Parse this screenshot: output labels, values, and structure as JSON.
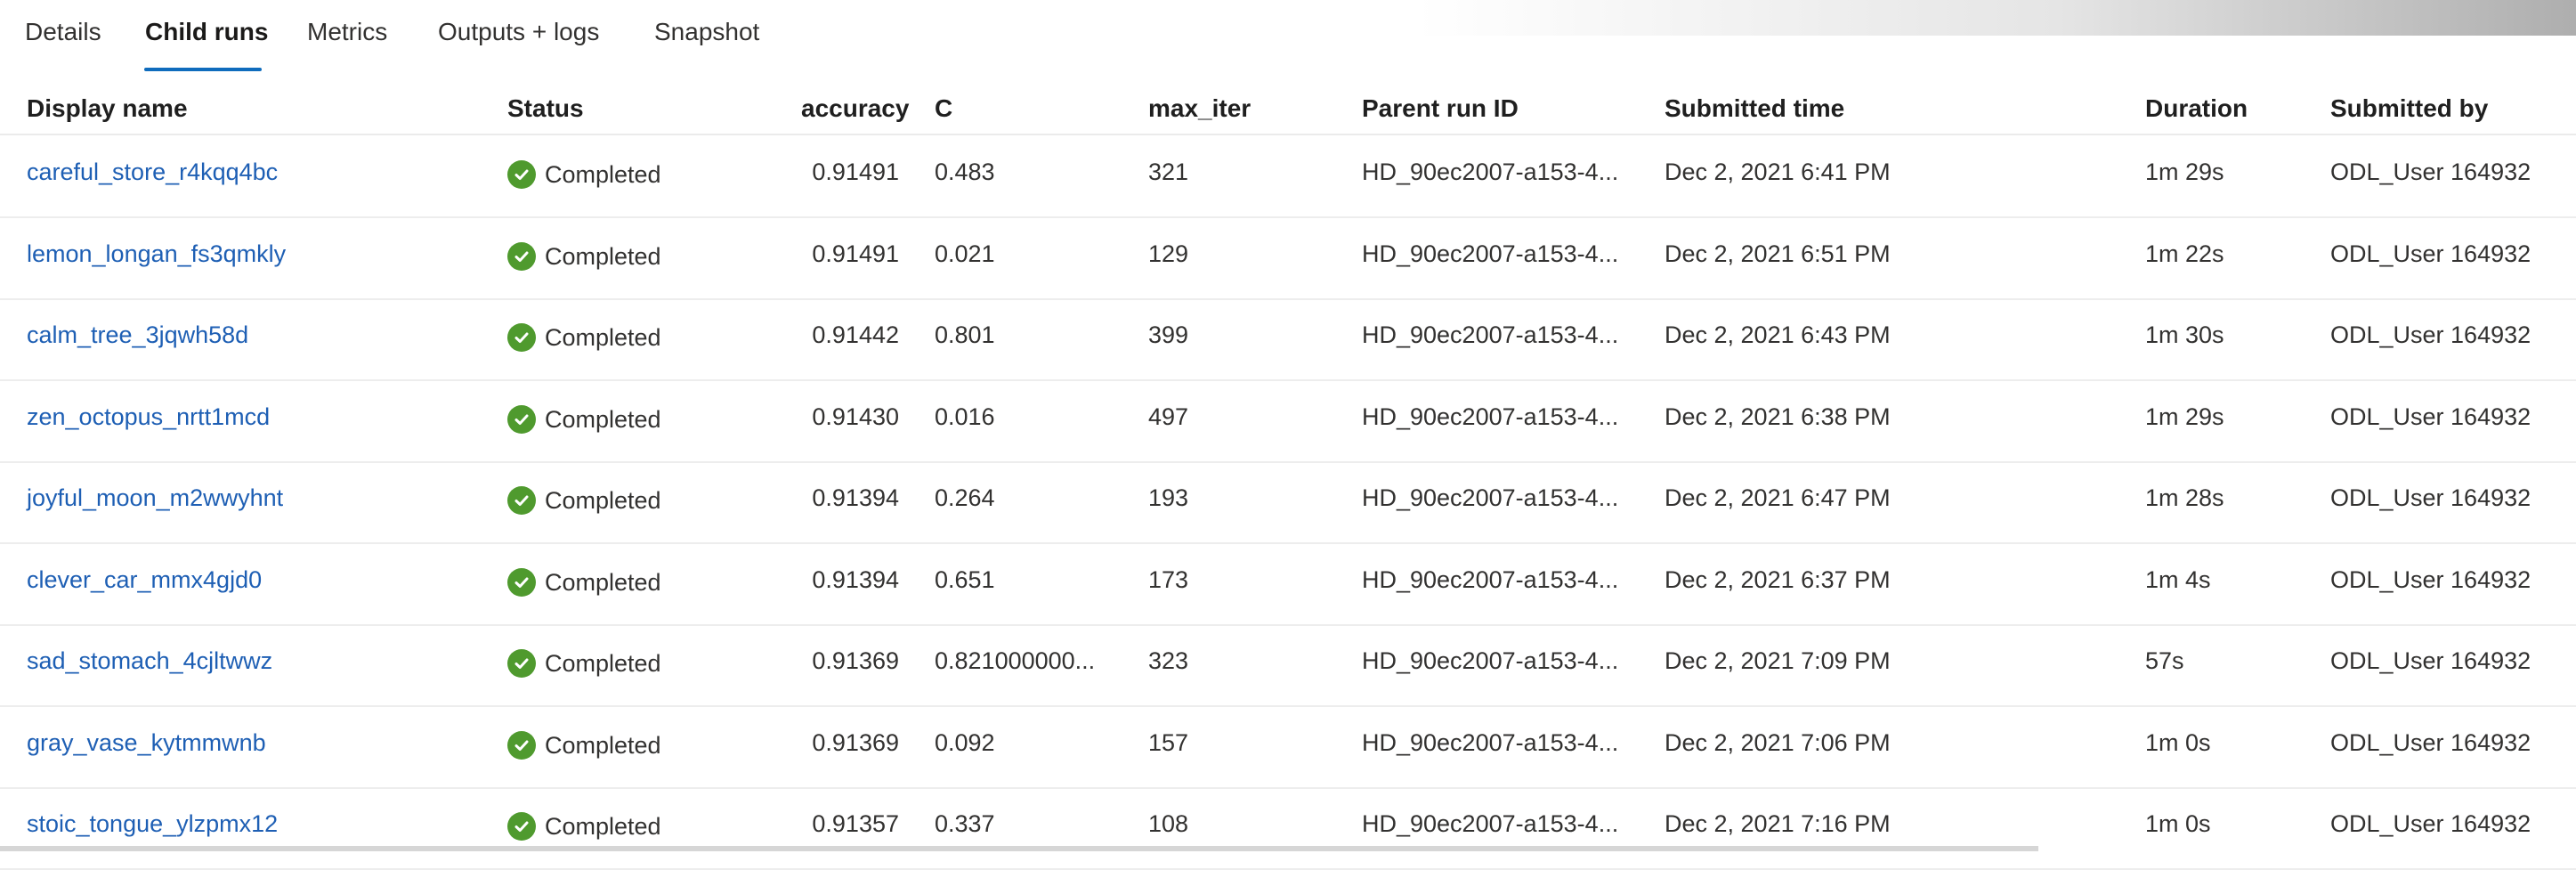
{
  "tabs": [
    {
      "label": "Details"
    },
    {
      "label": "Child runs"
    },
    {
      "label": "Metrics"
    },
    {
      "label": "Outputs + logs"
    },
    {
      "label": "Snapshot"
    }
  ],
  "active_tab": "Child runs",
  "columns": {
    "display_name": "Display name",
    "status": "Status",
    "accuracy": "accuracy",
    "c": "C",
    "max_iter": "max_iter",
    "parent_run_id": "Parent run ID",
    "submitted_time": "Submitted time",
    "duration": "Duration",
    "submitted_by": "Submitted by"
  },
  "rows": [
    {
      "name": "careful_store_r4kqq4bc",
      "status": "Completed",
      "accuracy": "0.91491",
      "c": "0.483",
      "max_iter": "321",
      "parent": "HD_90ec2007-a153-4...",
      "time": "Dec 2, 2021 6:41 PM",
      "duration": "1m 29s",
      "user": "ODL_User 164932"
    },
    {
      "name": "lemon_longan_fs3qmkly",
      "status": "Completed",
      "accuracy": "0.91491",
      "c": "0.021",
      "max_iter": "129",
      "parent": "HD_90ec2007-a153-4...",
      "time": "Dec 2, 2021 6:51 PM",
      "duration": "1m 22s",
      "user": "ODL_User 164932"
    },
    {
      "name": "calm_tree_3jqwh58d",
      "status": "Completed",
      "accuracy": "0.91442",
      "c": "0.801",
      "max_iter": "399",
      "parent": "HD_90ec2007-a153-4...",
      "time": "Dec 2, 2021 6:43 PM",
      "duration": "1m 30s",
      "user": "ODL_User 164932"
    },
    {
      "name": "zen_octopus_nrtt1mcd",
      "status": "Completed",
      "accuracy": "0.91430",
      "c": "0.016",
      "max_iter": "497",
      "parent": "HD_90ec2007-a153-4...",
      "time": "Dec 2, 2021 6:38 PM",
      "duration": "1m 29s",
      "user": "ODL_User 164932"
    },
    {
      "name": "joyful_moon_m2wwyhnt",
      "status": "Completed",
      "accuracy": "0.91394",
      "c": "0.264",
      "max_iter": "193",
      "parent": "HD_90ec2007-a153-4...",
      "time": "Dec 2, 2021 6:47 PM",
      "duration": "1m 28s",
      "user": "ODL_User 164932"
    },
    {
      "name": "clever_car_mmx4gjd0",
      "status": "Completed",
      "accuracy": "0.91394",
      "c": "0.651",
      "max_iter": "173",
      "parent": "HD_90ec2007-a153-4...",
      "time": "Dec 2, 2021 6:37 PM",
      "duration": "1m 4s",
      "user": "ODL_User 164932"
    },
    {
      "name": "sad_stomach_4cjltwwz",
      "status": "Completed",
      "accuracy": "0.91369",
      "c": "0.821000000...",
      "max_iter": "323",
      "parent": "HD_90ec2007-a153-4...",
      "time": "Dec 2, 2021 7:09 PM",
      "duration": "57s",
      "user": "ODL_User 164932"
    },
    {
      "name": "gray_vase_kytmmwnb",
      "status": "Completed",
      "accuracy": "0.91369",
      "c": "0.092",
      "max_iter": "157",
      "parent": "HD_90ec2007-a153-4...",
      "time": "Dec 2, 2021 7:06 PM",
      "duration": "1m 0s",
      "user": "ODL_User 164932"
    },
    {
      "name": "stoic_tongue_ylzpmx12",
      "status": "Completed",
      "accuracy": "0.91357",
      "c": "0.337",
      "max_iter": "108",
      "parent": "HD_90ec2007-a153-4...",
      "time": "Dec 2, 2021 7:16 PM",
      "duration": "1m 0s",
      "user": "ODL_User 164932"
    }
  ],
  "colors": {
    "accent": "#0f6cbd",
    "link": "#1e5fb4",
    "success": "#4f9a2e"
  },
  "icons": {
    "status_completed": "check-circle-icon"
  }
}
